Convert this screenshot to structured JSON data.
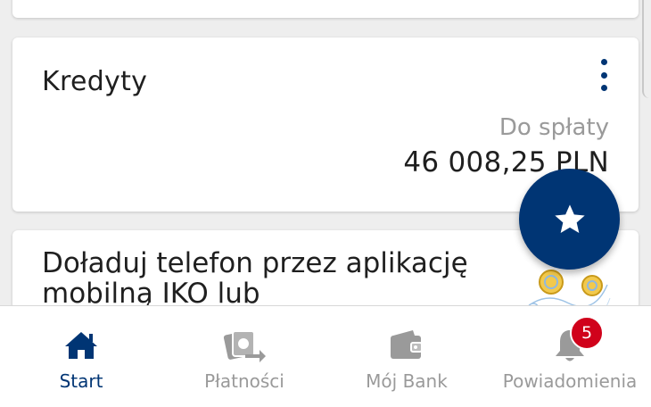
{
  "credits_card": {
    "title": "Kredyty",
    "due_label": "Do spłaty",
    "due_amount": "46 008,25 PLN"
  },
  "promo_card": {
    "text": "Doładuj telefon przez aplikację mobilną IKO lub"
  },
  "fab": {
    "icon": "star-icon"
  },
  "bottom_nav": {
    "items": [
      {
        "label": "Start",
        "icon": "home-icon",
        "active": true
      },
      {
        "label": "Płatności",
        "icon": "payments-icon",
        "active": false
      },
      {
        "label": "Mój Bank",
        "icon": "wallet-icon",
        "active": false
      },
      {
        "label": "Powiadomienia",
        "icon": "bell-icon",
        "active": false,
        "badge": "5"
      }
    ]
  },
  "colors": {
    "brand": "#003574",
    "muted": "#9a9a9a",
    "badge": "#d0021b"
  }
}
